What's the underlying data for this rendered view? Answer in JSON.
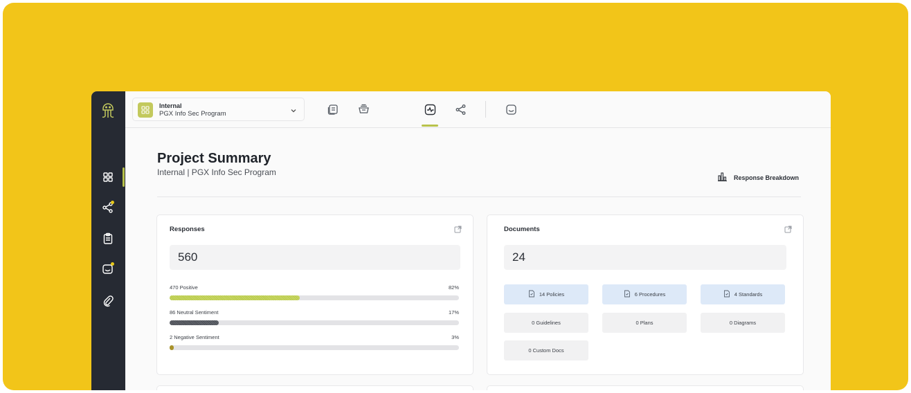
{
  "project": {
    "type": "Internal",
    "name": "PGX Info Sec Program"
  },
  "page": {
    "title": "Project Summary",
    "subtitle": "Internal | PGX Info Sec Program",
    "breakdown_label": "Response Breakdown"
  },
  "responses": {
    "title": "Responses",
    "total": "560",
    "metrics": [
      {
        "label": "470 Positive",
        "percent_label": "82%",
        "fraction": 0.45
      },
      {
        "label": "86 Neutral Sentiment",
        "percent_label": "17%",
        "fraction": 0.17
      },
      {
        "label": "2 Negative Sentiment",
        "percent_label": "3%",
        "fraction": 0.012
      }
    ]
  },
  "documents": {
    "title": "Documents",
    "total": "24",
    "chips": [
      {
        "label": "14 Policies",
        "active": true
      },
      {
        "label": "6 Procedures",
        "active": true
      },
      {
        "label": "4 Standards",
        "active": true
      },
      {
        "label": "0 Guidelines",
        "active": false
      },
      {
        "label": "0 Plans",
        "active": false
      },
      {
        "label": "0 Diagrams",
        "active": false
      },
      {
        "label": "0 Custom Docs",
        "active": false
      }
    ]
  },
  "colors": {
    "background": "#f2c519",
    "sidebar": "#262a33",
    "accent": "#b8c24a",
    "active_chip": "#dde9f8"
  },
  "icons": {
    "sidebar": [
      "logo-icon",
      "dashboard-icon",
      "share-icon",
      "clipboard-icon",
      "inbox-icon",
      "paperclip-icon"
    ],
    "toolbar": [
      "documents-icon",
      "inbox-tray-icon",
      "activity-icon",
      "share-icon",
      "mailbox-icon"
    ]
  }
}
